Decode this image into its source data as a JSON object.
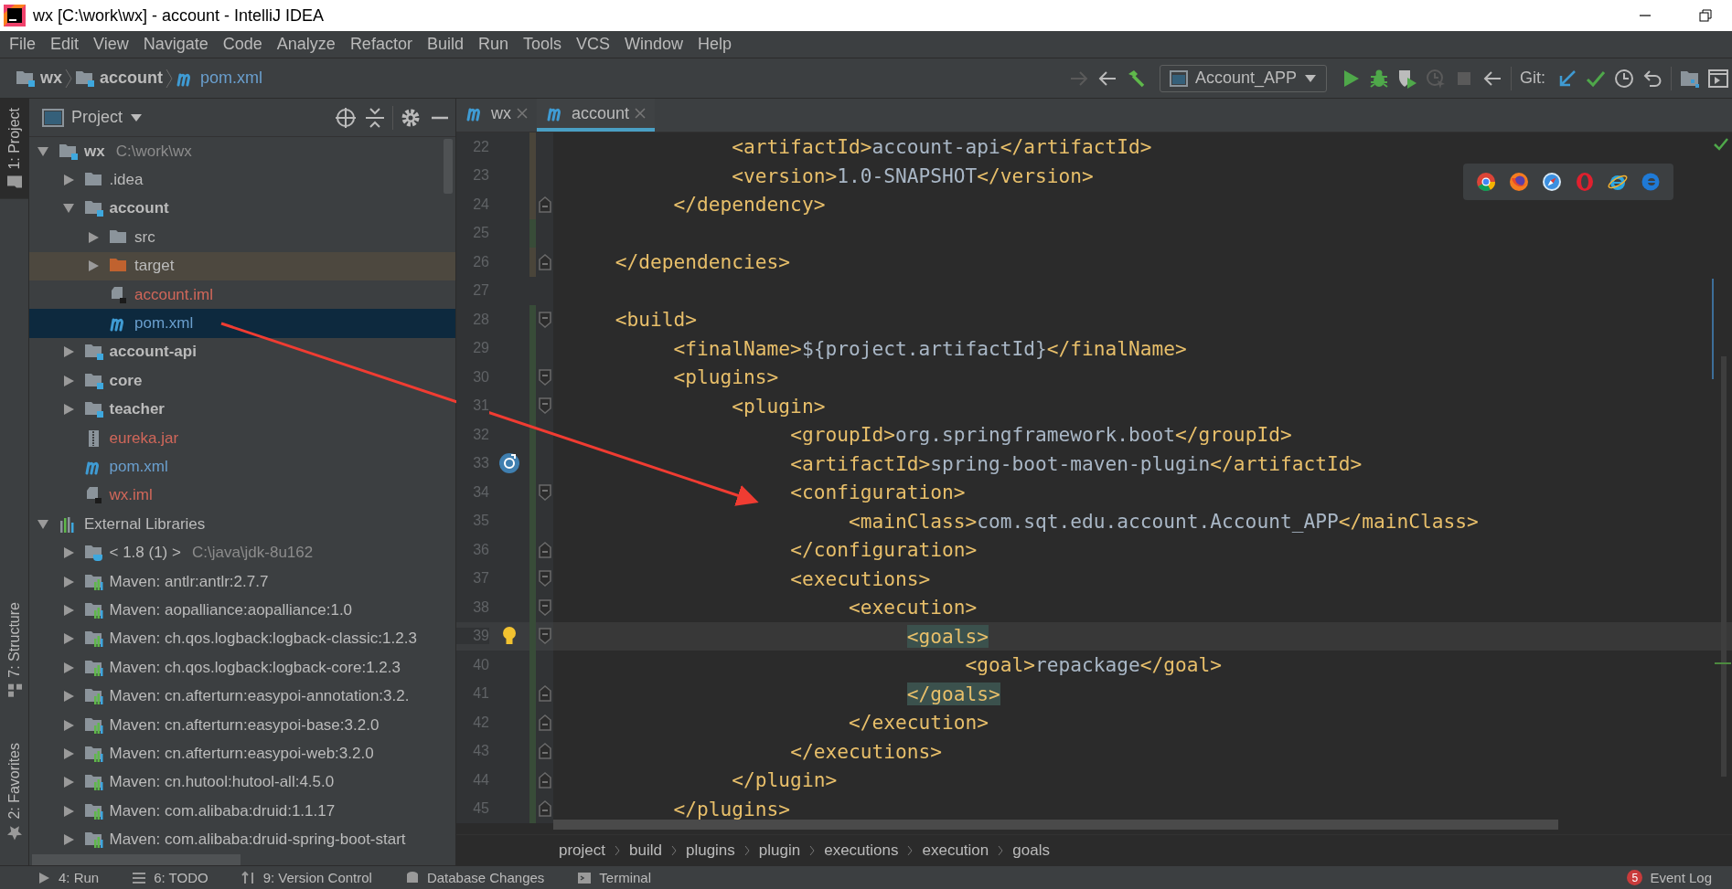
{
  "window": {
    "title": "wx [C:\\work\\wx] - account - IntelliJ IDEA"
  },
  "menu": [
    "File",
    "Edit",
    "View",
    "Navigate",
    "Code",
    "Analyze",
    "Refactor",
    "Build",
    "Run",
    "Tools",
    "VCS",
    "Window",
    "Help"
  ],
  "navigation": {
    "breadcrumb": [
      {
        "label": "wx",
        "kind": "module"
      },
      {
        "label": "account",
        "kind": "module"
      },
      {
        "label": "pom.xml",
        "kind": "maven"
      }
    ],
    "run_config": "Account_APP",
    "git_label": "Git:"
  },
  "tool_windows": [
    {
      "label": "1: Project",
      "kind": "project",
      "selected": true
    },
    {
      "label": "7: Structure",
      "kind": "structure",
      "selected": false
    },
    {
      "label": "2: Favorites",
      "kind": "favorites",
      "selected": false
    }
  ],
  "project_panel": {
    "title": "Project",
    "tree": [
      {
        "label": "wx",
        "secondary": "C:\\work\\wx",
        "kind": "module",
        "color": "#bbbbbb",
        "expanded": true,
        "selected": false,
        "children": [
          {
            "label": ".idea",
            "kind": "folder",
            "color": "#bbbbbb",
            "expanded": false,
            "selected": false
          },
          {
            "label": "account",
            "kind": "module",
            "color": "#bbbbbb",
            "expanded": true,
            "selected": false,
            "children": [
              {
                "label": "src",
                "kind": "folder",
                "color": "#bbbbbb",
                "expanded": false,
                "selected": false
              },
              {
                "label": "target",
                "kind": "excluded",
                "color": "#bbbbbb",
                "expanded": false,
                "selected": false
              },
              {
                "label": "account.iml",
                "kind": "iml",
                "color": "#d1675a",
                "selected": false
              },
              {
                "label": "pom.xml",
                "kind": "maven",
                "color": "#6a9fce",
                "selected": true
              }
            ]
          },
          {
            "label": "account-api",
            "kind": "module",
            "color": "#bbbbbb",
            "expanded": false,
            "selected": false
          },
          {
            "label": "core",
            "kind": "module",
            "color": "#bbbbbb",
            "expanded": false,
            "selected": false
          },
          {
            "label": "teacher",
            "kind": "module",
            "color": "#bbbbbb",
            "expanded": false,
            "selected": false
          },
          {
            "label": "eureka.jar",
            "kind": "jar",
            "color": "#d1675a",
            "selected": false
          },
          {
            "label": "pom.xml",
            "kind": "maven",
            "color": "#6a9fce",
            "selected": false
          },
          {
            "label": "wx.iml",
            "kind": "iml",
            "color": "#d1675a",
            "selected": false
          }
        ]
      },
      {
        "label": "External Libraries",
        "kind": "libraries",
        "color": "#bbbbbb",
        "expanded": true,
        "selected": false,
        "children": [
          {
            "label": "< 1.8 (1) >",
            "secondary": "C:\\java\\jdk-8u162",
            "kind": "jdk",
            "color": "#bbbbbb",
            "expanded": false,
            "selected": false
          },
          {
            "label": "Maven: antlr:antlr:2.7.7",
            "kind": "library",
            "color": "#bbbbbb",
            "expanded": false,
            "selected": false
          },
          {
            "label": "Maven: aopalliance:aopalliance:1.0",
            "kind": "library",
            "color": "#bbbbbb",
            "expanded": false,
            "selected": false
          },
          {
            "label": "Maven: ch.qos.logback:logback-classic:1.2.3",
            "kind": "library",
            "color": "#bbbbbb",
            "expanded": false,
            "selected": false
          },
          {
            "label": "Maven: ch.qos.logback:logback-core:1.2.3",
            "kind": "library",
            "color": "#bbbbbb",
            "expanded": false,
            "selected": false
          },
          {
            "label": "Maven: cn.afterturn:easypoi-annotation:3.2.",
            "kind": "library",
            "color": "#bbbbbb",
            "expanded": false,
            "selected": false
          },
          {
            "label": "Maven: cn.afterturn:easypoi-base:3.2.0",
            "kind": "library",
            "color": "#bbbbbb",
            "expanded": false,
            "selected": false
          },
          {
            "label": "Maven: cn.afterturn:easypoi-web:3.2.0",
            "kind": "library",
            "color": "#bbbbbb",
            "expanded": false,
            "selected": false
          },
          {
            "label": "Maven: cn.hutool:hutool-all:4.5.0",
            "kind": "library",
            "color": "#bbbbbb",
            "expanded": false,
            "selected": false
          },
          {
            "label": "Maven: com.alibaba:druid:1.1.17",
            "kind": "library",
            "color": "#bbbbbb",
            "expanded": false,
            "selected": false
          },
          {
            "label": "Maven: com.alibaba:druid-spring-boot-start",
            "kind": "library",
            "color": "#bbbbbb",
            "expanded": false,
            "selected": false
          }
        ]
      }
    ]
  },
  "editor": {
    "tabs": [
      {
        "label": "wx",
        "selected": false
      },
      {
        "label": "account",
        "selected": true
      }
    ],
    "lines": [
      {
        "number": "22",
        "text": "               <artifactId>account-api</artifactId>",
        "kind": "plain",
        "color": "#4a453a",
        "fold_start": false,
        "fold_end": false,
        "current": false,
        "matched": false
      },
      {
        "number": "23",
        "text": "               <version>1.0-SNAPSHOT</version>",
        "kind": "plain",
        "color": "#4a453a",
        "fold_start": false,
        "fold_end": false,
        "current": false,
        "matched": false
      },
      {
        "number": "24",
        "text": "          </dependency>",
        "kind": "plain",
        "color": "#4a453a",
        "fold_start": false,
        "fold_end": true,
        "current": false,
        "matched": false
      },
      {
        "number": "25",
        "kind": "plain",
        "color": "#384c38",
        "fold_start": false,
        "fold_end": false,
        "current": false
      },
      {
        "number": "26",
        "text": "     </dependencies>",
        "kind": "plain",
        "color": "#4a453a",
        "fold_start": false,
        "fold_end": true,
        "current": false,
        "matched": false
      },
      {
        "number": "27",
        "kind": "plain",
        "fold_start": false,
        "fold_end": false,
        "current": false
      },
      {
        "number": "28",
        "text": "     <build>",
        "kind": "plain",
        "color": "#384c38",
        "fold_start": true,
        "fold_end": false,
        "current": false,
        "matched": false
      },
      {
        "number": "29",
        "text": "          <finalName>${project.artifactId}</finalName>",
        "kind": "plain",
        "color": "#384c38",
        "fold_start": false,
        "fold_end": false,
        "current": false,
        "matched": false
      },
      {
        "number": "30",
        "text": "          <plugins>",
        "kind": "plain",
        "color": "#384c38",
        "fold_start": true,
        "fold_end": false,
        "current": false,
        "matched": false
      },
      {
        "number": "31",
        "text": "               <plugin>",
        "kind": "plain",
        "color": "#384c38",
        "fold_start": true,
        "fold_end": false,
        "current": false,
        "matched": false
      },
      {
        "number": "32",
        "text": "                    <groupId>org.springframework.boot</groupId>",
        "kind": "plain",
        "color": "#384c38",
        "fold_start": false,
        "fold_end": false,
        "current": false,
        "matched": false
      },
      {
        "number": "33",
        "text": "                    <artifactId>spring-boot-maven-plugin</artifactId>",
        "kind": "run",
        "color": "#384c38",
        "fold_start": false,
        "fold_end": false,
        "current": false,
        "matched": false
      },
      {
        "number": "34",
        "text": "                    <configuration>",
        "kind": "plain",
        "color": "#384c38",
        "fold_start": true,
        "fold_end": false,
        "current": false,
        "matched": false
      },
      {
        "number": "35",
        "text": "                         <mainClass>com.sqt.edu.account.Account_APP</mainClass>",
        "kind": "plain",
        "color": "#384c38",
        "fold_start": false,
        "fold_end": false,
        "current": false,
        "matched": false
      },
      {
        "number": "36",
        "text": "                    </configuration>",
        "kind": "plain",
        "color": "#384c38",
        "fold_start": false,
        "fold_end": true,
        "current": false,
        "matched": false
      },
      {
        "number": "37",
        "text": "                    <executions>",
        "kind": "plain",
        "color": "#384c38",
        "fold_start": true,
        "fold_end": false,
        "current": false,
        "matched": false
      },
      {
        "number": "38",
        "text": "                         <execution>",
        "kind": "plain",
        "color": "#384c38",
        "fold_start": true,
        "fold_end": false,
        "current": false,
        "matched": false
      },
      {
        "number": "39",
        "text": "                              <goals>",
        "kind": "bulb",
        "color": "#384c38",
        "fold_start": true,
        "fold_end": false,
        "current": true,
        "matched": true
      },
      {
        "number": "40",
        "text": "                                   <goal>repackage</goal>",
        "kind": "plain",
        "color": "#384c38",
        "fold_start": false,
        "fold_end": false,
        "current": false,
        "matched": false
      },
      {
        "number": "41",
        "text": "                              </goals>",
        "kind": "plain",
        "color": "#384c38",
        "fold_start": false,
        "fold_end": true,
        "current": false,
        "matched": true
      },
      {
        "number": "42",
        "text": "                         </execution>",
        "kind": "plain",
        "color": "#384c38",
        "fold_start": false,
        "fold_end": true,
        "current": false,
        "matched": false
      },
      {
        "number": "43",
        "text": "                    </executions>",
        "kind": "plain",
        "color": "#384c38",
        "fold_start": false,
        "fold_end": true,
        "current": false,
        "matched": false
      },
      {
        "number": "44",
        "text": "               </plugin>",
        "kind": "plain",
        "color": "#384c38",
        "fold_start": false,
        "fold_end": true,
        "current": false,
        "matched": false
      },
      {
        "number": "45",
        "text": "          </plugins>",
        "kind": "plain",
        "color": "#384c38",
        "fold_start": false,
        "fold_end": true,
        "current": false,
        "matched": false
      }
    ],
    "breadcrumb": [
      "project",
      "build",
      "plugins",
      "plugin",
      "executions",
      "execution",
      "goals"
    ]
  },
  "bottom_bar": {
    "tools": [
      {
        "label": "4: Run",
        "kind": "run"
      },
      {
        "label": "6: TODO",
        "kind": "todo"
      },
      {
        "label": "9: Version Control",
        "kind": "vcs"
      },
      {
        "label": "Database Changes",
        "kind": "database"
      },
      {
        "label": "Terminal",
        "kind": "terminal"
      }
    ],
    "event_log": {
      "label": "Event Log",
      "badge": "5"
    }
  }
}
